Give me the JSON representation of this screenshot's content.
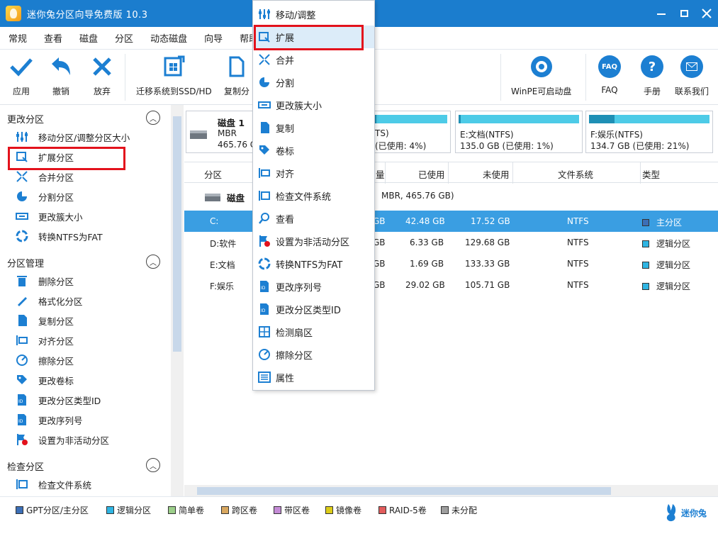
{
  "window": {
    "title": "迷你兔分区向导免费版 10.3"
  },
  "menubar": [
    "常规",
    "查看",
    "磁盘",
    "分区",
    "动态磁盘",
    "向导",
    "帮助"
  ],
  "toolbar": {
    "apply": "应用",
    "undo": "撤销",
    "discard": "放弃",
    "migrate": "迁移系统到SSD/HD",
    "copy": "复制分",
    "winpe": "WinPE可启动盘",
    "faq": "FAQ",
    "manual": "手册",
    "contact": "联系我们"
  },
  "sidebar": {
    "change_partition": {
      "header": "更改分区",
      "items": [
        "移动分区/调整分区大小",
        "扩展分区",
        "合并分区",
        "分割分区",
        "更改簇大小",
        "转换NTFS为FAT"
      ]
    },
    "partition_management": {
      "header": "分区管理",
      "items": [
        "删除分区",
        "格式化分区",
        "复制分区",
        "对齐分区",
        "擦除分区",
        "更改卷标",
        "更改分区类型ID",
        "更改序列号",
        "设置为非活动分区"
      ]
    },
    "check_partition": {
      "header": "检查分区",
      "items": [
        "检查文件系统"
      ]
    }
  },
  "disk_cards": {
    "disk": {
      "name": "磁盘 1",
      "type": "MBR",
      "size": "465.76 G"
    },
    "partitions": [
      {
        "line1": "TS)",
        "line2": "(已使用: 4%)",
        "used_fraction": 0.04
      },
      {
        "line1": "E:文档(NTFS)",
        "line2": "135.0 GB (已使用: 1%)",
        "used_fraction": 0.01
      },
      {
        "line1": "F:娱乐(NTFS)",
        "line2": "134.7 GB (已使用: 21%)",
        "used_fraction": 0.21
      }
    ]
  },
  "table": {
    "headers": {
      "partition": "分区",
      "capacity": "量",
      "used": "已使用",
      "unused": "未使用",
      "filesystem": "文件系统",
      "type": "类型"
    },
    "disk_row": {
      "name": "磁盘",
      "info": "MBR, 465.76 GB)"
    },
    "rows": [
      {
        "name": "C:",
        "cap": "GB",
        "used": "42.48 GB",
        "unused": "17.52 GB",
        "fs": "NTFS",
        "type": "主分区",
        "color": "#3c6fb7",
        "selected": true
      },
      {
        "name": "D:软件",
        "cap": "GB",
        "used": "6.33 GB",
        "unused": "129.68 GB",
        "fs": "NTFS",
        "type": "逻辑分区",
        "color": "#2fb5e3",
        "selected": false
      },
      {
        "name": "E:文档",
        "cap": "GB",
        "used": "1.69 GB",
        "unused": "133.33 GB",
        "fs": "NTFS",
        "type": "逻辑分区",
        "color": "#2fb5e3",
        "selected": false
      },
      {
        "name": "F:娱乐",
        "cap": "GB",
        "used": "29.02 GB",
        "unused": "105.71 GB",
        "fs": "NTFS",
        "type": "逻辑分区",
        "color": "#2fb5e3",
        "selected": false
      }
    ]
  },
  "legend": [
    {
      "label": "GPT分区/主分区",
      "color": "#3c6fb7"
    },
    {
      "label": "逻辑分区",
      "color": "#2fb5e3"
    },
    {
      "label": "简单卷",
      "color": "#9ccf8a"
    },
    {
      "label": "跨区卷",
      "color": "#d9a860"
    },
    {
      "label": "带区卷",
      "color": "#c48bd6"
    },
    {
      "label": "镜像卷",
      "color": "#dccc18"
    },
    {
      "label": "RAID-5卷",
      "color": "#e25c5c"
    },
    {
      "label": "未分配",
      "color": "#9e9e9e"
    }
  ],
  "brand": "迷你兔",
  "context_menu": [
    "移动/调整",
    "扩展",
    "合并",
    "分割",
    "更改簇大小",
    "复制",
    "卷标",
    "对齐",
    "检查文件系统",
    "查看",
    "设置为非活动分区",
    "转换NTFS为FAT",
    "更改序列号",
    "更改分区类型ID",
    "检测扇区",
    "擦除分区",
    "属性"
  ],
  "colors": {
    "accent": "#1b7dce",
    "selection": "#3a9ee2",
    "highlight_box": "#e3121c"
  }
}
